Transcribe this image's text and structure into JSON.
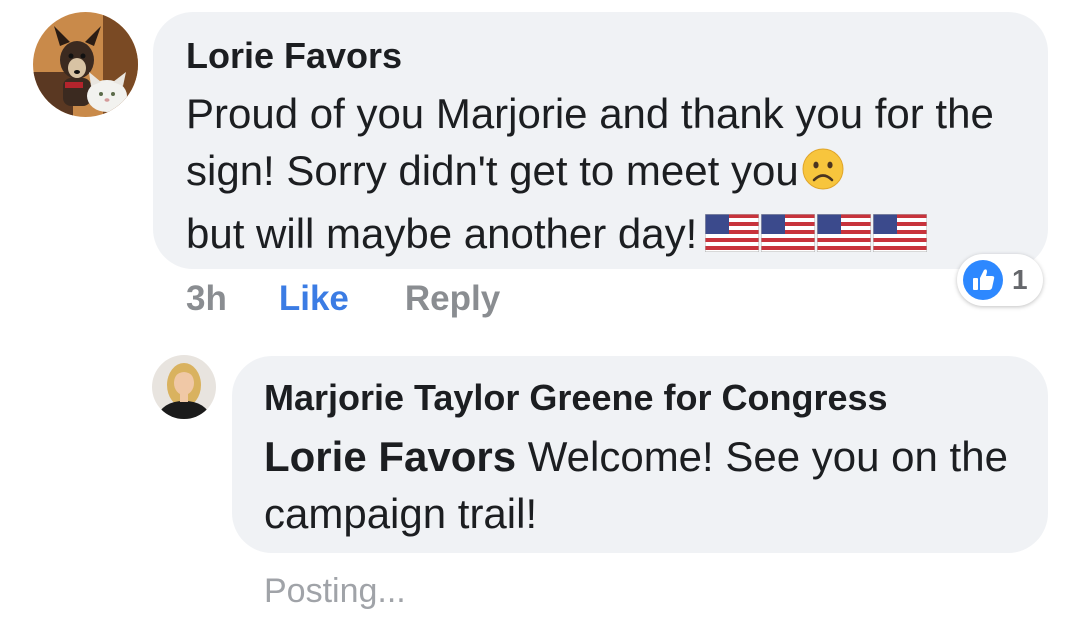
{
  "comment": {
    "author": "Lorie Favors",
    "text": "Proud of you Marjorie and thank you for the sign! Sorry didn't get to meet you",
    "text_after_emoji": "but will maybe another day!",
    "emoji": "frowning-face-icon",
    "flags": [
      "us-flag-icon",
      "us-flag-icon",
      "us-flag-icon",
      "us-flag-icon"
    ],
    "timestamp": "3h",
    "like_label": "Like",
    "reply_label": "Reply",
    "reaction_count": "1",
    "reaction_icon": "thumbs-up-icon"
  },
  "reply": {
    "author": "Marjorie Taylor Greene for Congress",
    "mention": "Lorie Favors",
    "text": "Welcome! See you on the campaign trail!",
    "status": "Posting..."
  },
  "colors": {
    "bubble": "#f0f2f5",
    "link_blue": "#3b7ce4",
    "muted": "#8a8d91",
    "text": "#1c1e21"
  }
}
